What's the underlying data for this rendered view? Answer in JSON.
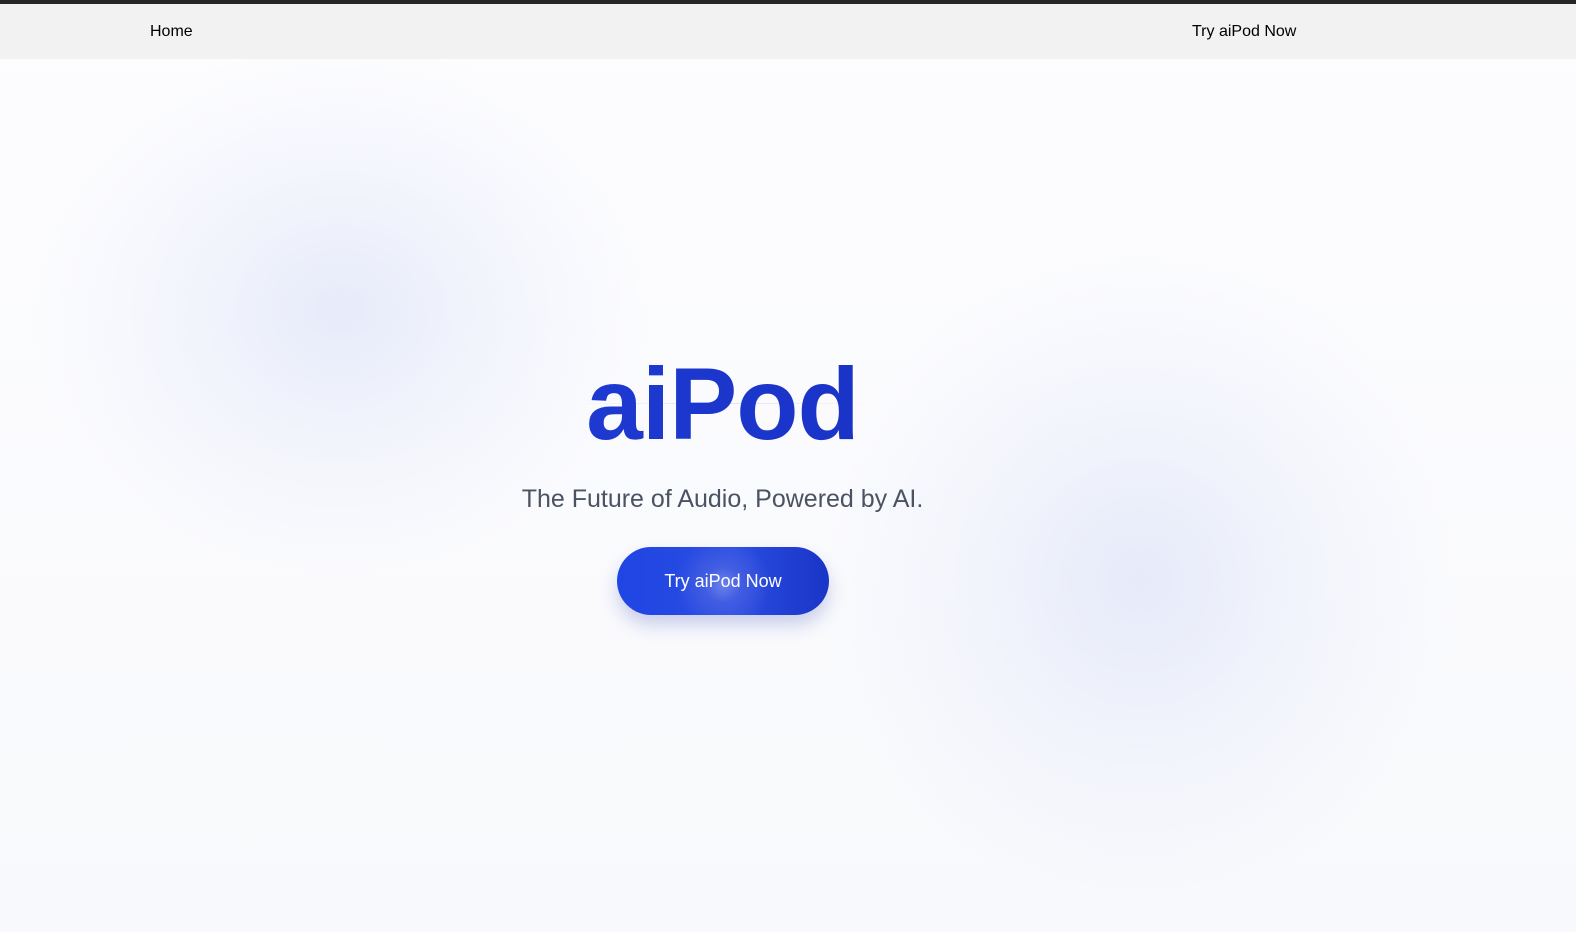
{
  "nav": {
    "home_label": "Home",
    "cta_label": "Try aiPod Now"
  },
  "hero": {
    "title": "aiPod",
    "subtitle": "The Future of Audio, Powered by AI.",
    "button_label": "Try aiPod Now"
  },
  "colors": {
    "top_border": "#262626",
    "nav_background": "#eeeeef",
    "title_blue": "#1d3bd8",
    "title_blue_dark": "#1829a7",
    "subtitle_gray": "#4b5362",
    "button_blue": "#2447e6",
    "button_text": "#ffffff",
    "page_background": "#f8f9fc"
  }
}
